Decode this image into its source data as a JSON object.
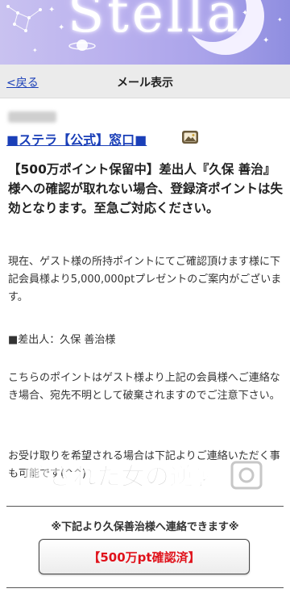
{
  "header": {
    "brand": "Stella"
  },
  "nav": {
    "back_label": "<戻る",
    "title": "メール表示"
  },
  "message": {
    "sender": "■ステラ【公式】窓口■",
    "sender_icon": "image-icon",
    "subject": "【500万ポイント保留中】差出人『久保 善治』様への確認が取れない場合、登録済ポイントは失効となります。至急ご対応ください。",
    "paragraphs": [
      "現在、ゲスト様の所持ポイントにてご確認頂けます様に下記会員様より5,000,000ptプレゼントのご案内がございます。",
      "■差出人：久保 善治様",
      "こちらのポイントはゲスト様より上記の会員様へご連絡なき場合、宛先不明として破棄されますのでご注意下さい。",
      "お受け取りを希望される場合は下記よりご連絡いただく事も可能です(^^)"
    ],
    "watermark": "騙された女の逆襲",
    "notice": "※下記より久保善治様へ連絡できます※",
    "confirm_button": "【500万pt確認済】"
  },
  "colors": {
    "link": "#1a3fb8",
    "button_text": "#e0121b",
    "banner_start": "#c9c2f0",
    "banner_end": "#8f8ee0"
  }
}
